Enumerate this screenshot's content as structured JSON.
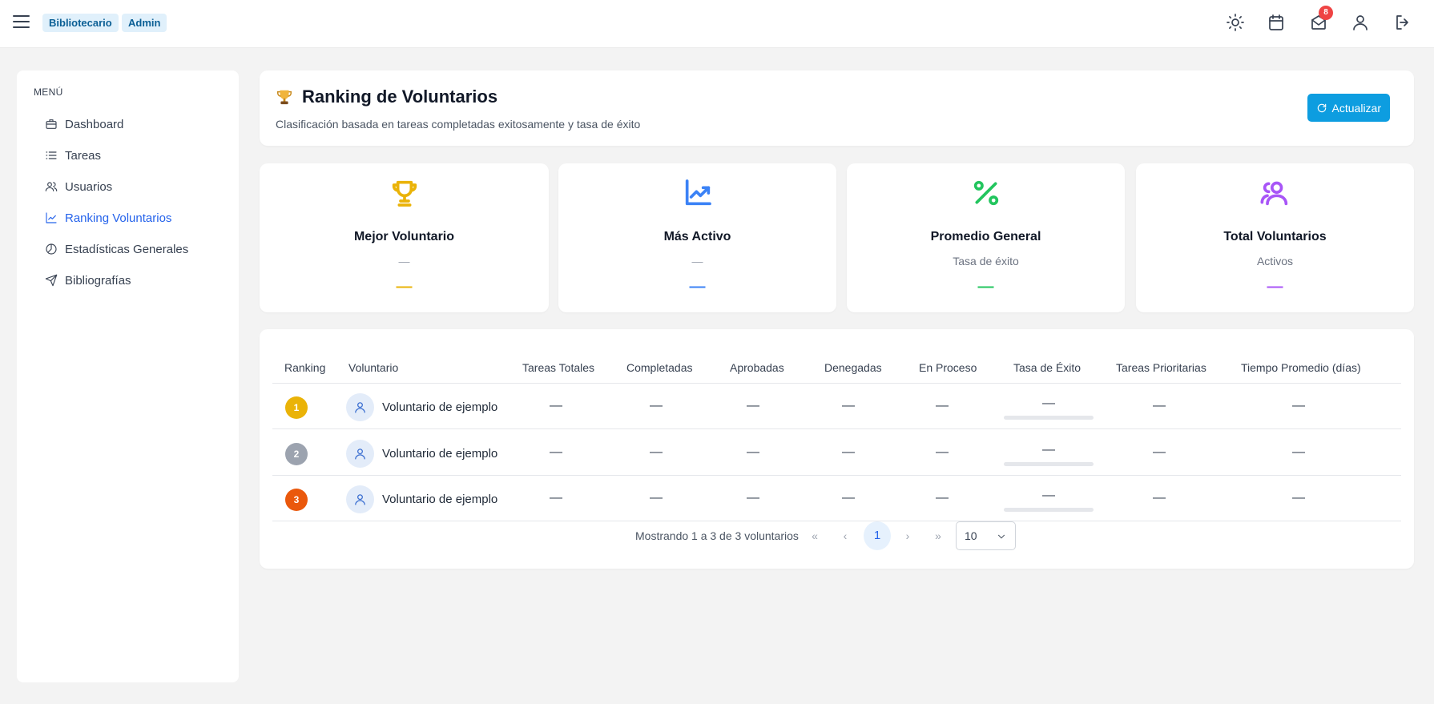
{
  "topbar": {
    "roles": [
      "Bibliotecario",
      "Admin"
    ],
    "notification_count": "8"
  },
  "sidebar": {
    "menu_title": "MENÚ",
    "items": [
      {
        "label": "Dashboard",
        "icon": "briefcase-icon"
      },
      {
        "label": "Tareas",
        "icon": "list-icon"
      },
      {
        "label": "Usuarios",
        "icon": "users-icon"
      },
      {
        "label": "Ranking Voluntarios",
        "icon": "chart-line-icon",
        "active": true
      },
      {
        "label": "Estadísticas Generales",
        "icon": "pie-chart-icon"
      },
      {
        "label": "Bibliografías",
        "icon": "send-icon"
      }
    ]
  },
  "header": {
    "title": "Ranking de Voluntarios",
    "subtitle": "Clasificación basada en tareas completadas exitosamente y tasa de éxito",
    "refresh_label": "Actualizar"
  },
  "stats": [
    {
      "title": "Mejor Voluntario",
      "subtitle": "—",
      "value": "—",
      "color": "#eab308",
      "icon": "trophy-icon"
    },
    {
      "title": "Más Activo",
      "subtitle": "—",
      "value": "—",
      "color": "#3b82f6",
      "icon": "trending-up-icon"
    },
    {
      "title": "Promedio General",
      "subtitle": "Tasa de éxito",
      "value": "—",
      "color": "#22c55e",
      "icon": "percent-icon"
    },
    {
      "title": "Total Voluntarios",
      "subtitle": "Activos",
      "value": "—",
      "color": "#a855f7",
      "icon": "users-icon"
    }
  ],
  "table": {
    "columns": [
      "Ranking",
      "Voluntario",
      "Tareas Totales",
      "Completadas",
      "Aprobadas",
      "Denegadas",
      "En Proceso",
      "Tasa de Éxito",
      "Tareas Prioritarias",
      "Tiempo Promedio (días)"
    ],
    "rows": [
      {
        "rank": "1",
        "rank_color": "#eab308",
        "name": "Voluntario de ejemplo",
        "total": "—",
        "completed": "—",
        "approved": "—",
        "denied": "—",
        "in_progress": "—",
        "success_rate": "—",
        "priority": "—",
        "avg_time": "—"
      },
      {
        "rank": "2",
        "rank_color": "#9ca3af",
        "name": "Voluntario de ejemplo",
        "total": "—",
        "completed": "—",
        "approved": "—",
        "denied": "—",
        "in_progress": "—",
        "success_rate": "—",
        "priority": "—",
        "avg_time": "—"
      },
      {
        "rank": "3",
        "rank_color": "#ea580c",
        "name": "Voluntario de ejemplo",
        "total": "—",
        "completed": "—",
        "approved": "—",
        "denied": "—",
        "in_progress": "—",
        "success_rate": "—",
        "priority": "—",
        "avg_time": "—"
      }
    ]
  },
  "pagination": {
    "info": "Mostrando 1 a 3 de 3 voluntarios",
    "current_page": "1",
    "page_size": "10"
  }
}
